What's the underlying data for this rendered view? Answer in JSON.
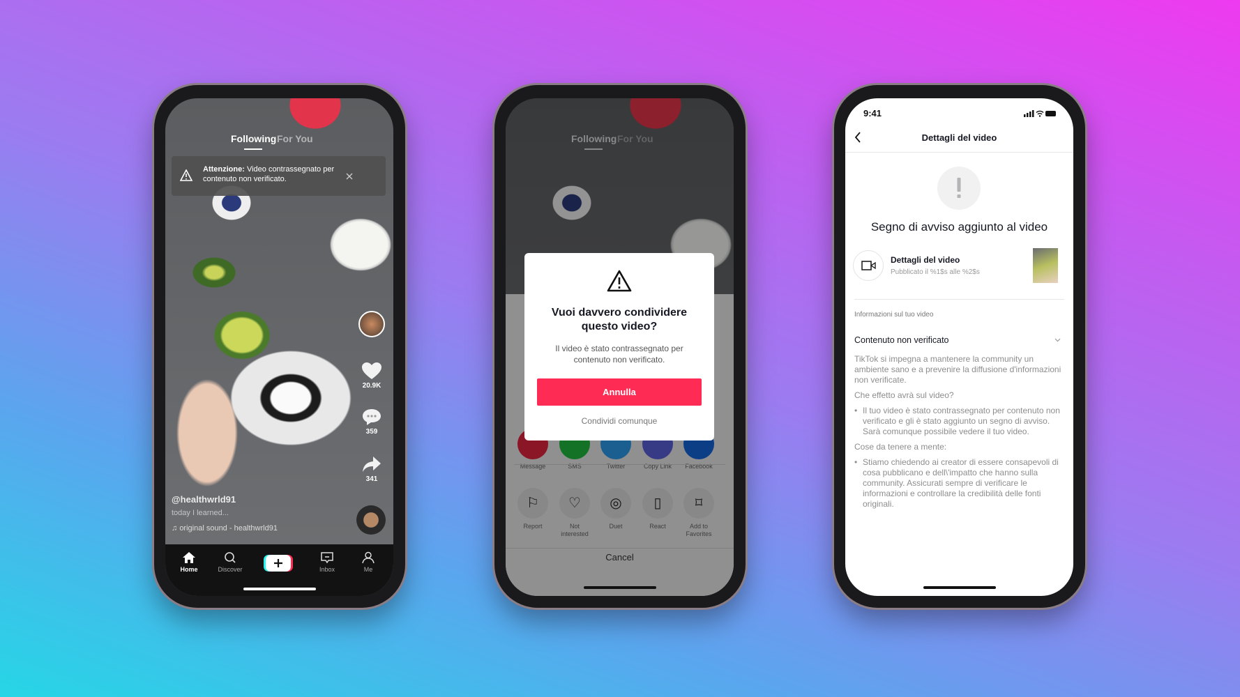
{
  "phone1": {
    "tabs": [
      "Following",
      "For You"
    ],
    "banner": {
      "bold": "Attenzione:",
      "text": " Video contrassegnato per contenuto non verificato.",
      "icon": "warning-icon",
      "close_icon": "close-icon"
    },
    "likes": "20.9K",
    "comments": "359",
    "shares": "341",
    "username": "@healthwrld91",
    "caption": "today I learned...",
    "sound": "original sound - healthwrld91",
    "nav": [
      {
        "label": "Home",
        "icon": "home-icon"
      },
      {
        "label": "Discover",
        "icon": "search-icon"
      },
      {
        "label": "",
        "icon": "plus-icon"
      },
      {
        "label": "Inbox",
        "icon": "inbox-icon"
      },
      {
        "label": "Me",
        "icon": "person-icon"
      }
    ]
  },
  "phone2": {
    "tabs": [
      "Following",
      "For You"
    ],
    "dialog": {
      "title": "Vuoi davvero condividere questo video?",
      "body": "Il video è stato contrassegnato per contenuto non verificato.",
      "primary": "Annulla",
      "secondary": "Condividi comunque",
      "accent": "#fe2c55"
    },
    "share_row": [
      {
        "label": "Message",
        "color": "#e0243e"
      },
      {
        "label": "SMS",
        "color": "#1fb83c"
      },
      {
        "label": "Twitter",
        "color": "#2b9ae8"
      },
      {
        "label": "Copy Link",
        "color": "#5a5fd8"
      },
      {
        "label": "Facebook",
        "color": "#1464d8"
      }
    ],
    "action_row": [
      "Report",
      "Not interested",
      "Duet",
      "React",
      "Add to Favorites"
    ],
    "cancel": "Cancel"
  },
  "phone3": {
    "time": "9:41",
    "title": "Dettagli del video",
    "heading": "Segno di avviso aggiunto al video",
    "row_title": "Dettagli del video",
    "row_sub": "Pubblicato il %1$s alle %2$s",
    "section": "Informazioni sul tuo video",
    "accordion": "Contenuto non verificato",
    "p1": "TikTok si impegna a mantenere la community un ambiente sano e a prevenire la diffusione d'informazioni non verificate.",
    "q1": "Che effetto avrà sul video?",
    "b1": "Il tuo video è stato contrassegnato per contenuto non verificato e gli è stato aggiunto un segno di avviso. Sarà comunque possibile vedere il tuo video.",
    "q2": "Cose da tenere a mente:",
    "b2": "Stiamo chiedendo ai creator di essere consapevoli di cosa pubblicano e dell\\'impatto che hanno sulla community. Assicurati sempre di verificare le informazioni e controllare la credibilità delle fonti originali."
  }
}
